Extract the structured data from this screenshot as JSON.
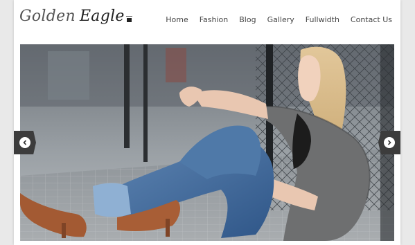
{
  "site": {
    "logo_word1": "Golden",
    "logo_word2": "Eagle"
  },
  "nav": {
    "items": [
      {
        "label": "Home"
      },
      {
        "label": "Fashion"
      },
      {
        "label": "Blog"
      },
      {
        "label": "Gallery"
      },
      {
        "label": "Fullwidth"
      },
      {
        "label": "Contact Us"
      }
    ]
  },
  "slider": {
    "prev_icon": "chevron-left-icon",
    "next_icon": "chevron-right-icon"
  },
  "colors": {
    "page_background": "#e9e9e9",
    "nav_text": "#444444",
    "arrow_background": "#3c3c3c"
  }
}
